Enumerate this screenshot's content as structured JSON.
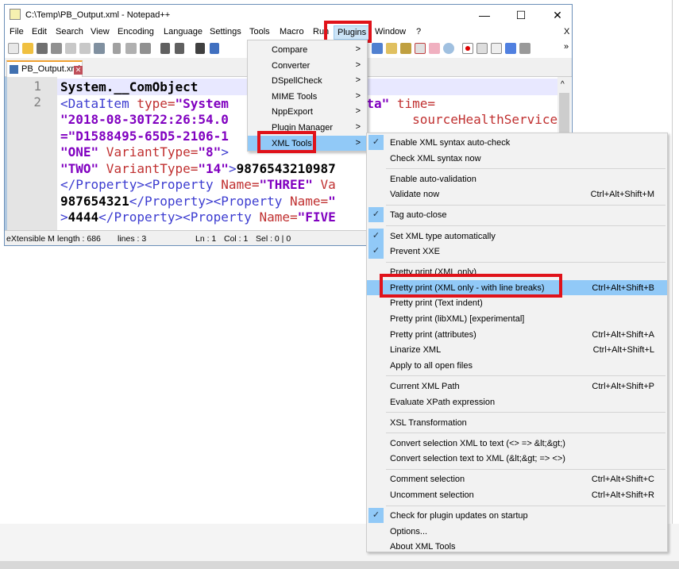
{
  "window": {
    "title": "C:\\Temp\\PB_Output.xml - Notepad++",
    "minimize": "—",
    "maximize": "☐",
    "close": "✕",
    "close_doc": "X"
  },
  "menubar": [
    "File",
    "Edit",
    "Search",
    "View",
    "Encoding",
    "Language",
    "Settings",
    "Tools",
    "Macro",
    "Run",
    "Plugins",
    "Window",
    "?"
  ],
  "toolbar_overflow": "»",
  "tab": {
    "label": "PB_Output.xml",
    "close": "✕"
  },
  "editor": {
    "line_numbers": [
      "1",
      "2"
    ],
    "lines": [
      [
        [
          "System.__ComObject",
          "txt"
        ]
      ],
      [
        [
          "<DataItem ",
          "tag"
        ],
        [
          "type=",
          "attr"
        ],
        [
          "\"System",
          "val"
        ],
        [
          "                  ",
          "txt"
        ],
        [
          "ta\"",
          "val"
        ],
        [
          " time=",
          "attr"
        ]
      ],
      [
        [
          "\"2018-08-30T22:26:54.0",
          "val"
        ],
        [
          "                        ",
          "txt"
        ],
        [
          "sourceHealthServiceId",
          "attr"
        ]
      ],
      [
        [
          "=\"D1588495-65D5-2106-1",
          "val"
        ]
      ],
      [
        [
          "\"ONE\"",
          "val"
        ],
        [
          " VariantType=",
          "attr"
        ],
        [
          "\"8\"",
          "val"
        ],
        [
          ">",
          "tag"
        ]
      ],
      [
        [
          "\"TWO\"",
          "val"
        ],
        [
          " VariantType=",
          "attr"
        ],
        [
          "\"14\"",
          "val"
        ],
        [
          ">",
          "tag"
        ],
        [
          "9876543210987",
          "txt"
        ]
      ],
      [
        [
          "</Property><Property ",
          "tag"
        ],
        [
          "Name=",
          "attr"
        ],
        [
          "\"THREE\"",
          "val"
        ],
        [
          " Va",
          "attr"
        ]
      ],
      [
        [
          "987654321",
          "txt"
        ],
        [
          "</Property><Property ",
          "tag"
        ],
        [
          "Name=",
          "attr"
        ],
        [
          "\"",
          "val"
        ]
      ],
      [
        [
          ">",
          "tag"
        ],
        [
          "4444",
          "txt"
        ],
        [
          "</Property><Property ",
          "tag"
        ],
        [
          "Name=",
          "attr"
        ],
        [
          "\"FIVE",
          "val"
        ]
      ]
    ]
  },
  "statusbar": {
    "type": "eXtensible M",
    "length": "length : 686",
    "lines": "lines : 3",
    "ln": "Ln : 1",
    "col": "Col : 1",
    "sel": "Sel : 0 | 0"
  },
  "plugins_menu": {
    "items": [
      "Compare",
      "Converter",
      "DSpellCheck",
      "MIME Tools",
      "NppExport",
      "Plugin Manager",
      "XML Tools"
    ],
    "highlighted": "XML Tools",
    "arrow": ">"
  },
  "xml_tools_menu": {
    "groups": [
      [
        {
          "label": "Enable XML syntax auto-check",
          "checked": true
        },
        {
          "label": "Check XML syntax now"
        }
      ],
      [
        {
          "label": "Enable auto-validation"
        },
        {
          "label": "Validate now",
          "shortcut": "Ctrl+Alt+Shift+M"
        }
      ],
      [
        {
          "label": "Tag auto-close",
          "checked": true
        }
      ],
      [
        {
          "label": "Set XML type automatically",
          "checked": true
        },
        {
          "label": "Prevent XXE",
          "checked": true
        }
      ],
      [
        {
          "label": "Pretty print (XML only)"
        },
        {
          "label": "Pretty print (XML only - with line breaks)",
          "shortcut": "Ctrl+Alt+Shift+B",
          "highlighted": true
        },
        {
          "label": "Pretty print (Text indent)"
        },
        {
          "label": "Pretty print (libXML) [experimental]"
        },
        {
          "label": "Pretty print (attributes)",
          "shortcut": "Ctrl+Alt+Shift+A"
        },
        {
          "label": "Linarize XML",
          "shortcut": "Ctrl+Alt+Shift+L"
        },
        {
          "label": "Apply to all open files"
        }
      ],
      [
        {
          "label": "Current XML Path",
          "shortcut": "Ctrl+Alt+Shift+P"
        },
        {
          "label": "Evaluate XPath expression"
        }
      ],
      [
        {
          "label": "XSL Transformation"
        }
      ],
      [
        {
          "label": "Convert selection XML to text (<> => &lt;&gt;)"
        },
        {
          "label": "Convert selection text to XML (&lt;&gt; => <>)"
        }
      ],
      [
        {
          "label": "Comment selection",
          "shortcut": "Ctrl+Alt+Shift+C"
        },
        {
          "label": "Uncomment selection",
          "shortcut": "Ctrl+Alt+Shift+R"
        }
      ],
      [
        {
          "label": "Check for plugin updates on startup",
          "checked": true
        },
        {
          "label": "Options..."
        },
        {
          "label": "About XML Tools"
        }
      ]
    ],
    "check_glyph": "✓"
  },
  "colors": {
    "highlight": "#91c9f7",
    "annotation": "#e0121a",
    "tag": "#3c3cd0",
    "attr": "#c03030",
    "value": "#8000c0"
  }
}
